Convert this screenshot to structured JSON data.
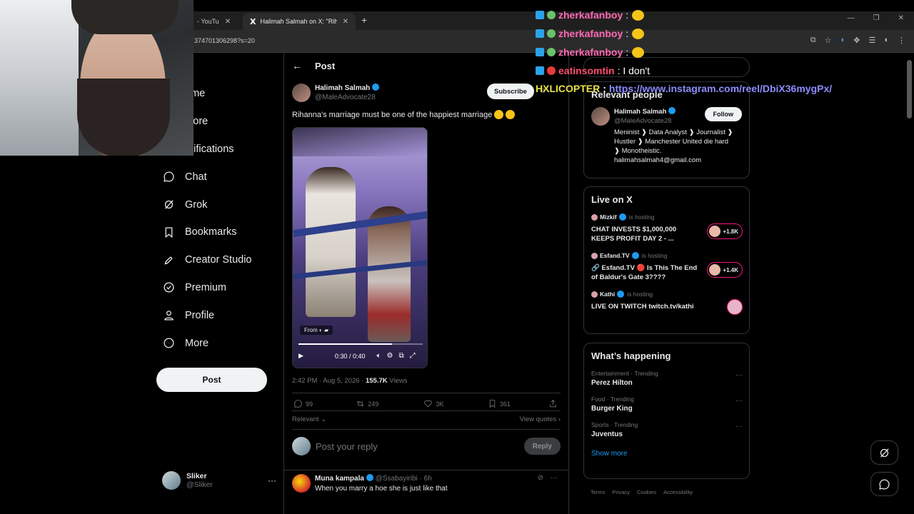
{
  "browser": {
    "tabs": [
      {
        "label": "- YouTu"
      },
      {
        "label": "Halimah Salmah on X: \"Rihann"
      }
    ],
    "url": "374701306298?s=20"
  },
  "chat": {
    "lines": [
      {
        "user": "zherkafanboy",
        "text": ":"
      },
      {
        "user": "zherkafanboy",
        "text": ":"
      },
      {
        "user": "zherkafanboy",
        "text": ":"
      },
      {
        "user": "eatinsomtin",
        "text": ": I don't"
      }
    ],
    "hx": {
      "user": "HXLICOPTER",
      "sep": ":",
      "link": "https://www.instagram.com/reel/DbiX36mygPx/"
    }
  },
  "nav": {
    "items": [
      {
        "label": "ome",
        "icon": "home-icon"
      },
      {
        "label": "plore",
        "icon": "explore-icon"
      },
      {
        "label": "otifications",
        "icon": "bell-icon"
      },
      {
        "label": "Chat",
        "icon": "chat-icon"
      },
      {
        "label": "Grok",
        "icon": "grok-icon"
      },
      {
        "label": "Bookmarks",
        "icon": "bookmark-icon"
      },
      {
        "label": "Creator Studio",
        "icon": "rocket-icon"
      },
      {
        "label": "Premium",
        "icon": "premium-icon"
      },
      {
        "label": "Profile",
        "icon": "person-icon"
      },
      {
        "label": "More",
        "icon": "more-circle-icon"
      }
    ],
    "post_label": "Post",
    "me": {
      "name": "Sliker",
      "handle": "@Sliker"
    }
  },
  "main": {
    "header_title": "Post",
    "author": {
      "name": "Halimah Salmah",
      "handle": "@MaleAdvocate28"
    },
    "subscribe_label": "Subscribe",
    "text": "Rihanna's marriage must be one of the happiest marriage",
    "video": {
      "from_label": "From",
      "time": "0:30 / 0:40",
      "progress": 0.75
    },
    "meta": {
      "time": "2:42 PM · Aug 5, 2026 · ",
      "views": "155.7K",
      "views_label": " Views"
    },
    "actions": {
      "replies": "99",
      "reposts": "249",
      "likes": "3K",
      "bookmarks": "361"
    },
    "sort_label": "Relevant",
    "view_quotes": "View quotes",
    "reply_placeholder": "Post your reply",
    "reply_button": "Reply",
    "reply": {
      "name": "Muna kampala",
      "handle": "@Ssabayiribi · 6h",
      "text": "When you marry a hoe she is just like that"
    }
  },
  "right": {
    "relevant": {
      "title": "Relevant people",
      "name": "Halimah Salmah",
      "handle": "@MaleAdvocate28",
      "follow_label": "Follow",
      "bio": "Meninist ❱ Data Analyst ❱ Journalist ❱ Hustler ❱ Manchester United die hard ❱ Monotheistic.",
      "email": "halimahsalmah4@gmail.com"
    },
    "live": {
      "title": "Live on X",
      "items": [
        {
          "host": "Mizkif",
          "status": "is hosting",
          "title": "CHAT INVESTS $1,000,000 KEEPS PROFIT DAY 2 - ...",
          "count": "+1.8K"
        },
        {
          "host": "Esfand.TV",
          "status": "is hosting",
          "title": "🔗 Esfand.TV 🔴 Is This The End of Baldur's Gate 3????",
          "count": "+1.4K"
        },
        {
          "host": "Kathi",
          "status": "is hosting",
          "title": "LIVE ON TWITCH twitch.tv/kathi",
          "count": ""
        }
      ]
    },
    "happening": {
      "title": "What’s happening",
      "trends": [
        {
          "category": "Entertainment · Trending",
          "name": "Perez Hilton"
        },
        {
          "category": "Food · Trending",
          "name": "Burger King"
        },
        {
          "category": "Sports · Trending",
          "name": "Juventus"
        }
      ],
      "show_more": "Show more"
    },
    "footer": [
      "Terms",
      "Privacy",
      "Cookies",
      "Accessibility"
    ]
  }
}
